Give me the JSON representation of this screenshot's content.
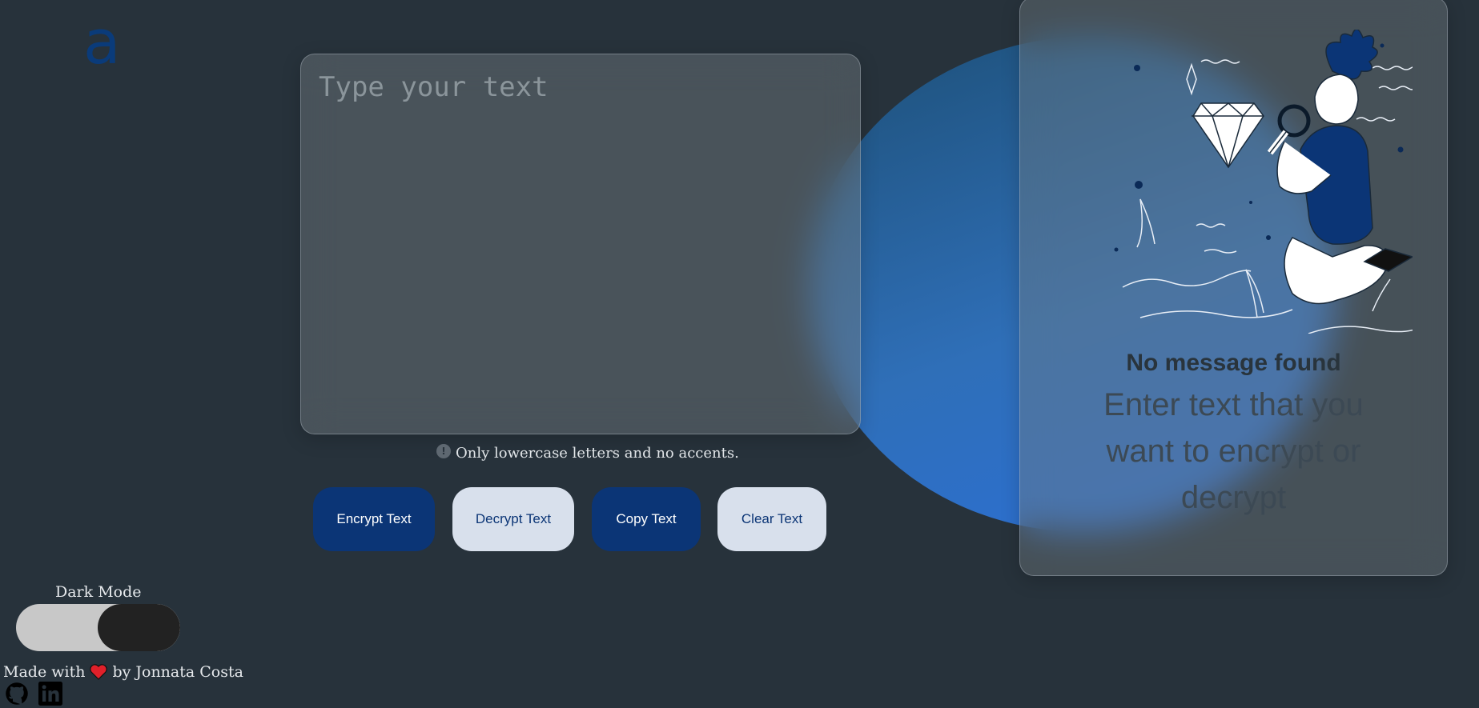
{
  "brand": {
    "logo_glyph": "a"
  },
  "input": {
    "placeholder": "Type your text",
    "value": ""
  },
  "hint": {
    "icon": "info-icon",
    "text": "Only lowercase letters and no accents."
  },
  "actions": {
    "encrypt_label": "Encrypt Text",
    "decrypt_label": "Decrypt Text",
    "copy_label": "Copy Text",
    "clear_label": "Clear Text"
  },
  "output": {
    "title": "No message found",
    "message": "Enter text that you want to encrypt or decrypt"
  },
  "theme": {
    "label": "Dark Mode"
  },
  "footer": {
    "made_with": "Made with",
    "by": "by Jonnata Costa",
    "heart_icon": "heart-icon",
    "links": [
      "github-icon",
      "linkedin-icon"
    ]
  },
  "colors": {
    "background": "#27323b",
    "primary": "#0b3576",
    "secondary": "#d8e0ec",
    "accent_blob": "#2f6fb8"
  }
}
